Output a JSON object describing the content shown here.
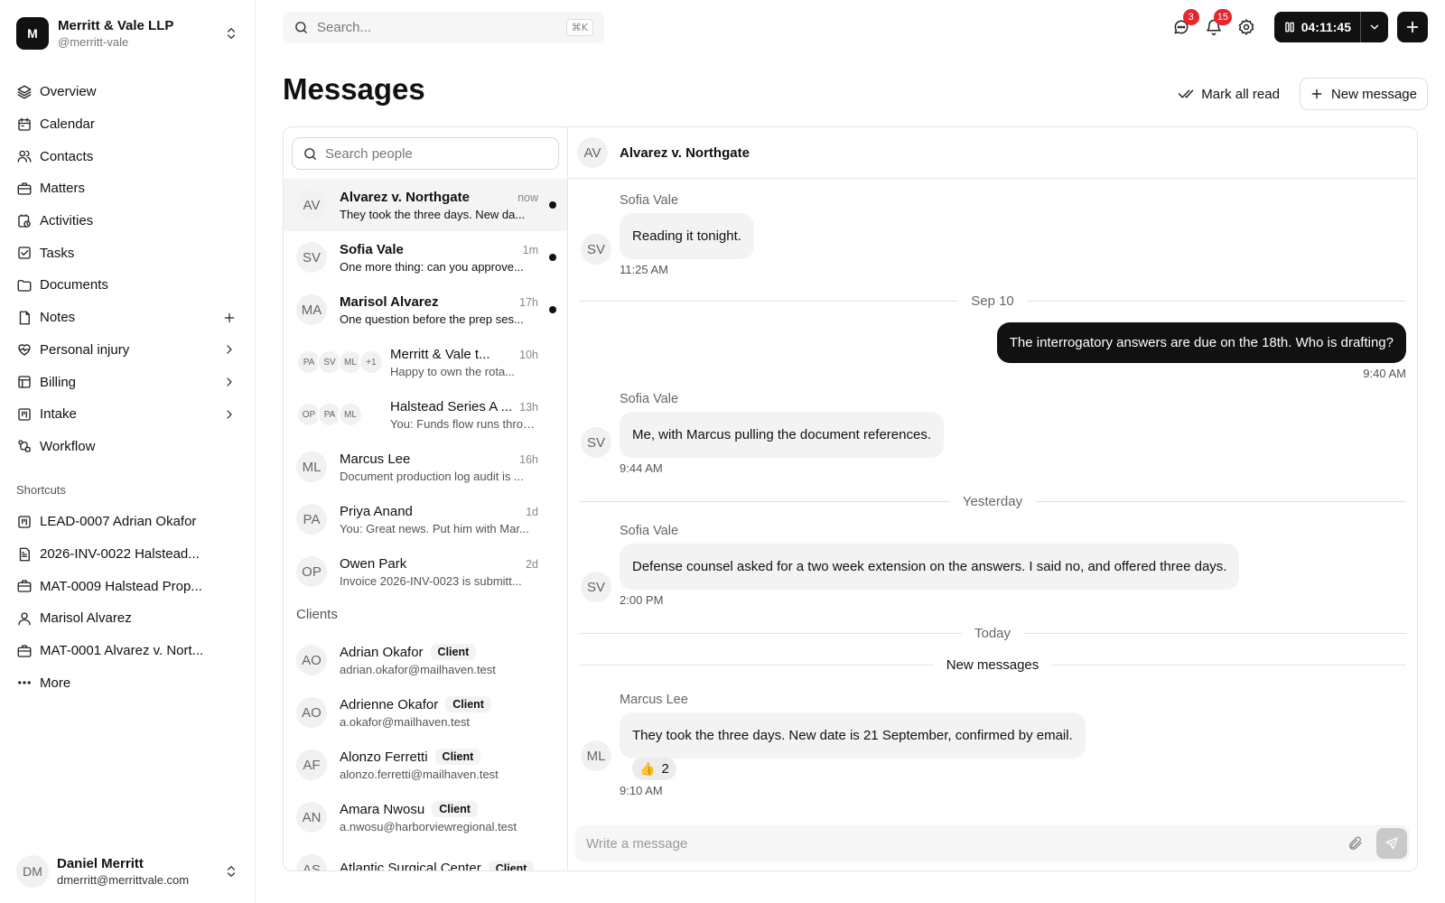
{
  "workspace": {
    "logo_letter": "M",
    "name": "Merritt & Vale LLP",
    "handle": "@merritt-vale"
  },
  "nav": [
    {
      "label": "Overview",
      "icon": "layers-icon"
    },
    {
      "label": "Calendar",
      "icon": "calendar-icon"
    },
    {
      "label": "Contacts",
      "icon": "users-icon"
    },
    {
      "label": "Matters",
      "icon": "briefcase-icon"
    },
    {
      "label": "Activities",
      "icon": "activity-clock-icon"
    },
    {
      "label": "Tasks",
      "icon": "check-square-icon"
    },
    {
      "label": "Documents",
      "icon": "folder-icon"
    },
    {
      "label": "Notes",
      "icon": "note-icon",
      "trailing": "plus-icon"
    },
    {
      "label": "Personal injury",
      "icon": "heart-pulse-icon",
      "trailing": "chevron-right-icon"
    },
    {
      "label": "Billing",
      "icon": "billing-icon",
      "trailing": "chevron-right-icon"
    },
    {
      "label": "Intake",
      "icon": "kanban-icon",
      "trailing": "chevron-right-icon"
    },
    {
      "label": "Workflow",
      "icon": "workflow-icon"
    }
  ],
  "shortcuts_heading": "Shortcuts",
  "shortcuts": [
    {
      "label": "LEAD-0007 Adrian Okafor",
      "icon": "kanban-icon"
    },
    {
      "label": "2026-INV-0022 Halstead...",
      "icon": "file-icon"
    },
    {
      "label": "MAT-0009 Halstead Prop...",
      "icon": "briefcase-icon"
    },
    {
      "label": "Marisol Alvarez",
      "icon": "user-icon"
    },
    {
      "label": "MAT-0001 Alvarez v. Nort...",
      "icon": "briefcase-icon"
    },
    {
      "label": "More",
      "icon": "more-icon"
    }
  ],
  "user": {
    "initials": "DM",
    "name": "Daniel Merritt",
    "email": "dmerritt@merrittvale.com"
  },
  "topbar": {
    "search_placeholder": "Search...",
    "shortcut": "⌘K",
    "messages_badge": "3",
    "notifications_badge": "15",
    "timer": "04:11:45"
  },
  "page": {
    "title": "Messages",
    "mark_all_read": "Mark all read",
    "new_message": "New message"
  },
  "people_search_placeholder": "Search people",
  "conversations": [
    {
      "initials": "AV",
      "name": "Alvarez v. Northgate",
      "time": "now",
      "preview": "They took the three days. New da...",
      "unread": true,
      "active": true
    },
    {
      "initials": "SV",
      "name": "Sofia Vale",
      "time": "1m",
      "preview": "One more thing: can you approve...",
      "unread": true
    },
    {
      "initials": "MA",
      "name": "Marisol Alvarez",
      "time": "17h",
      "preview": "One question before the prep ses...",
      "unread": true
    },
    {
      "group": [
        "PA",
        "SV",
        "ML"
      ],
      "more": "+1",
      "name": "Merritt & Vale t...",
      "time": "10h",
      "preview": "Happy to own the rota..."
    },
    {
      "group": [
        "OP",
        "PA",
        "ML"
      ],
      "name": "Halstead Series A ...",
      "time": "13h",
      "preview": "You: Funds flow runs throu..."
    },
    {
      "initials": "ML",
      "name": "Marcus Lee",
      "time": "16h",
      "preview": "Document production log audit is ..."
    },
    {
      "initials": "PA",
      "name": "Priya Anand",
      "time": "1d",
      "preview": "You: Great news. Put him with Mar..."
    },
    {
      "initials": "OP",
      "name": "Owen Park",
      "time": "2d",
      "preview": "Invoice 2026-INV-0023 is submitt..."
    }
  ],
  "clients_heading": "Clients",
  "clients": [
    {
      "initials": "AO",
      "name": "Adrian Okafor",
      "tag": "Client",
      "email": "adrian.okafor@mailhaven.test"
    },
    {
      "initials": "AO",
      "name": "Adrienne Okafor",
      "tag": "Client",
      "email": "a.okafor@mailhaven.test"
    },
    {
      "initials": "AF",
      "name": "Alonzo Ferretti",
      "tag": "Client",
      "email": "alonzo.ferretti@mailhaven.test"
    },
    {
      "initials": "AN",
      "name": "Amara Nwosu",
      "tag": "Client",
      "email": "a.nwosu@harborviewregional.test"
    },
    {
      "initials": "AS",
      "name": "Atlantic Surgical Center",
      "tag": "Client",
      "email": ""
    }
  ],
  "chat": {
    "initials": "AV",
    "title": "Alvarez v. Northgate",
    "m1": {
      "sender": "Sofia Vale",
      "initials": "SV",
      "text": "Reading it tonight.",
      "time": "11:25 AM"
    },
    "d1": "Sep 10",
    "m2": {
      "text": "The interrogatory answers are due on the 18th. Who is drafting?",
      "time": "9:40 AM"
    },
    "m3": {
      "sender": "Sofia Vale",
      "initials": "SV",
      "text": "Me, with Marcus pulling the document references.",
      "time": "9:44 AM"
    },
    "d2": "Yesterday",
    "m4": {
      "sender": "Sofia Vale",
      "initials": "SV",
      "text": "Defense counsel asked for a two week extension on the answers. I said no, and offered three days.",
      "time": "2:00 PM"
    },
    "d3": "Today",
    "d4": "New messages",
    "m5": {
      "sender": "Marcus Lee",
      "initials": "ML",
      "text": "They took the three days. New date is 21 September, confirmed by email.",
      "time": "9:10 AM",
      "reaction_emoji": "👍",
      "reaction_count": "2"
    },
    "compose_placeholder": "Write a message"
  },
  "colors": {
    "accent": "#111111",
    "badge": "#e5262b",
    "bubble": "#f3f3f3"
  }
}
